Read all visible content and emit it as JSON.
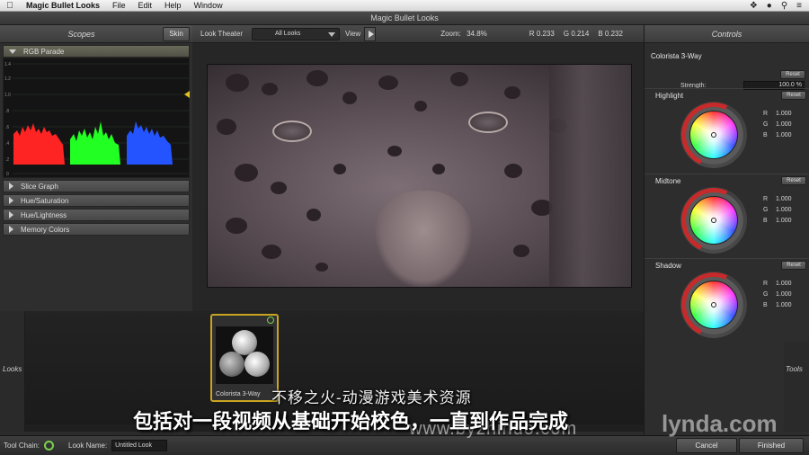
{
  "menubar": {
    "app_name": "Magic Bullet Looks",
    "items": [
      "File",
      "Edit",
      "Help",
      "Window"
    ]
  },
  "window": {
    "title": "Magic Bullet Looks"
  },
  "scopes": {
    "title": "Scopes",
    "skin_label": "Skin",
    "open_section": "RGB Parade",
    "axis_ticks": [
      "1.4",
      "1.2",
      "1.0",
      ".8",
      ".6",
      ".4",
      ".2",
      "0"
    ],
    "sections": [
      "Slice Graph",
      "Hue/Saturation",
      "Hue/Lightness",
      "Memory Colors"
    ],
    "colors": {
      "red": "#ff2020",
      "green": "#20ff20",
      "blue": "#2050ff"
    }
  },
  "viewer": {
    "look_theater_label": "Look Theater",
    "look_filter": "All Looks",
    "view_label": "View",
    "zoom_label": "Zoom:",
    "zoom_value": "34.8%",
    "r_label": "R",
    "r_value": "0.233",
    "g_label": "G",
    "g_value": "0.214",
    "b_label": "B",
    "b_value": "0.232"
  },
  "controls": {
    "title": "Controls",
    "tool_name": "Colorista 3-Way",
    "reset_label": "Reset",
    "strength_label": "Strength:",
    "strength_value": "100.0 %",
    "wheels": [
      {
        "name": "Highlight",
        "r": "1.000",
        "g": "1.000",
        "b": "1.000"
      },
      {
        "name": "Midtone",
        "r": "1.000",
        "g": "1.000",
        "b": "1.000"
      },
      {
        "name": "Shadow",
        "r": "1.000",
        "g": "1.000",
        "b": "1.000"
      }
    ],
    "accent_color": "#c62a2a"
  },
  "looks": {
    "side_label": "Looks",
    "tools_label": "Tools",
    "card_label": "Colorista 3-Way",
    "card_border_color": "#c9a421"
  },
  "bottombar": {
    "tool_chain_label": "Tool Chain:",
    "look_name_label": "Look Name:",
    "look_name_value": "Untitled Look",
    "cancel_label": "Cancel",
    "finished_label": "Finished",
    "power_color": "#7bd14b"
  },
  "overlay": {
    "watermark_top": "不移之火-动漫游戏美术资源",
    "subtitle": "包括对一段视频从基础开始校色，一直到作品完成",
    "watermark_url": "www.byzhihuo.com",
    "watermark_brand": "lynda.com"
  }
}
